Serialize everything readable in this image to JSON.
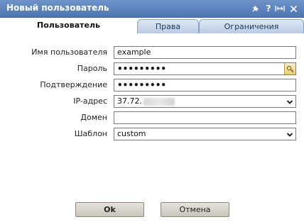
{
  "window": {
    "title": "Новый пользователь",
    "colors": {
      "titlebar": "#5a80bb",
      "tab_active": "#ffffff",
      "tab_inactive": "#c8d6ec"
    }
  },
  "tabs": [
    {
      "label": "Пользователь",
      "active": true
    },
    {
      "label": "Права",
      "active": false
    },
    {
      "label": "Ограничения",
      "active": false
    }
  ],
  "form": {
    "username": {
      "label": "Имя пользователя",
      "value": "example"
    },
    "password": {
      "label": "Пароль",
      "value": "•••••••••",
      "icon": "key-icon"
    },
    "confirm": {
      "label": "Подтверждение",
      "value": "•••••••••"
    },
    "ip": {
      "label": "IP-адрес",
      "value": "37.72."
    },
    "domain": {
      "label": "Домен",
      "value": ""
    },
    "template": {
      "label": "Шаблон",
      "value": "custom"
    }
  },
  "buttons": {
    "ok_label": "Ok",
    "cancel_label": "Отмена"
  }
}
